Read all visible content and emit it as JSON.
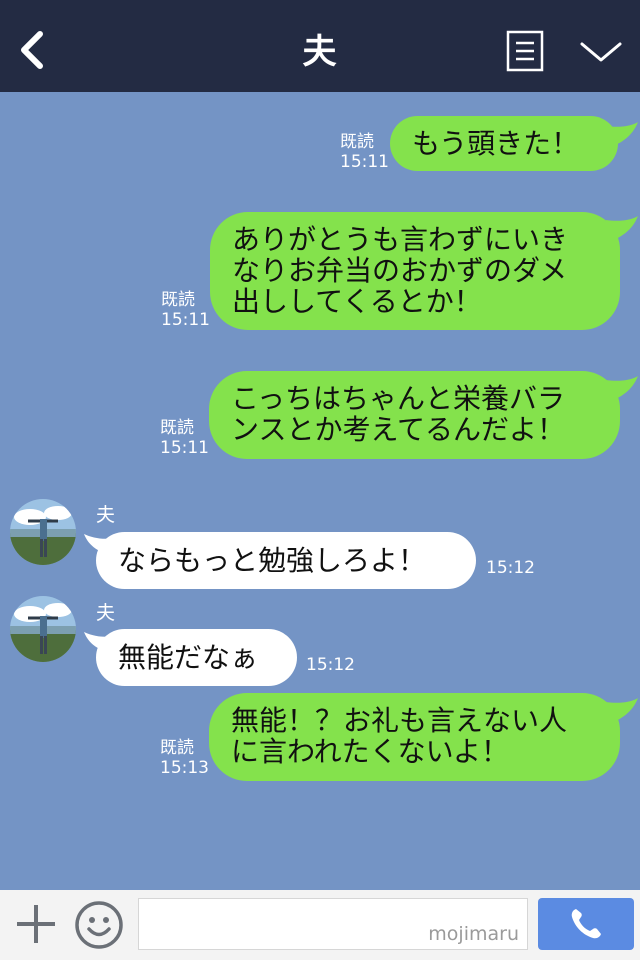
{
  "header": {
    "title": "夫"
  },
  "messages": [
    {
      "dir": "out",
      "text": "もう頭きた！",
      "read": "既読",
      "time": "15:11"
    },
    {
      "dir": "out",
      "text": "ありがとうも言わずにいき\nなりお弁当のおかずのダメ\n出ししてくるとか！",
      "read": "既読",
      "time": "15:11"
    },
    {
      "dir": "out",
      "text": "こっちはちゃんと栄養バラ\nンスとか考えてるんだよ！",
      "read": "既読",
      "time": "15:11"
    },
    {
      "dir": "in",
      "sender": "夫",
      "text": "ならもっと勉強しろよ！",
      "time": "15:12"
    },
    {
      "dir": "in",
      "sender": "夫",
      "text": "無能だなぁ",
      "time": "15:12"
    },
    {
      "dir": "out",
      "text": "無能！？お礼も言えない人\nに言われたくないよ！",
      "read": "既読",
      "time": "15:13"
    }
  ],
  "footer": {
    "watermark": "mojimaru"
  },
  "colors": {
    "header_bg": "#232b43",
    "chat_bg": "#7494c5",
    "out_bubble": "#84e24c",
    "in_bubble": "#ffffff",
    "call_button": "#5b8be2"
  },
  "icons": {
    "back": "chevron-left-icon",
    "menu": "menu-list-icon",
    "more": "chevron-down-icon",
    "plus": "plus-icon",
    "sticker": "smile-icon",
    "call": "phone-icon"
  }
}
